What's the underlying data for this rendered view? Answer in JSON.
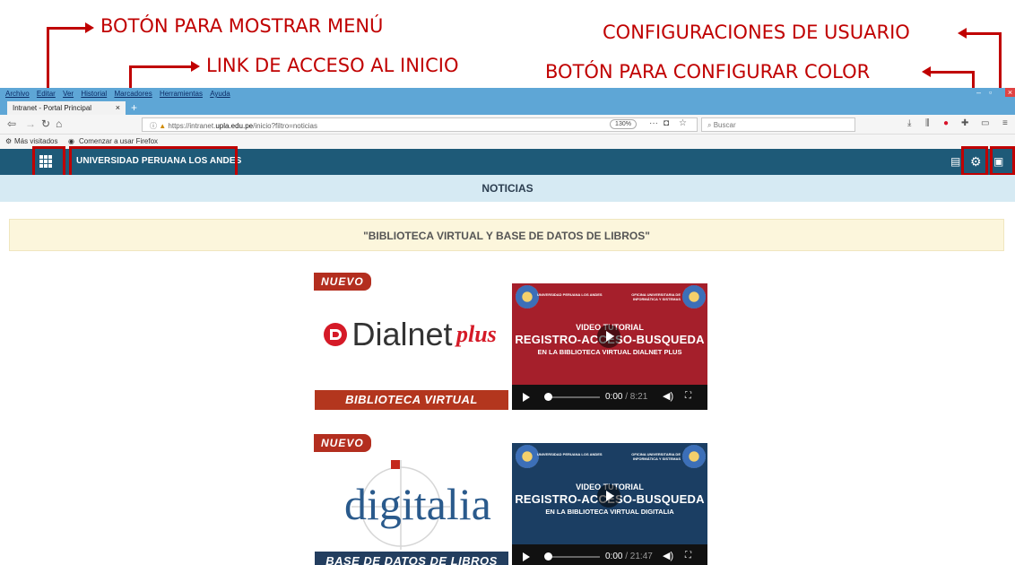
{
  "annotations": {
    "menu_button": "BOTÓN PARA MOSTRAR MENÚ",
    "home_link": "LINK DE ACCESO AL INICIO",
    "user_settings": "CONFIGURACIONES DE USUARIO",
    "color_button": "BOTÓN PARA CONFIGURAR COLOR"
  },
  "browser": {
    "menu": [
      "Archivo",
      "Editar",
      "Ver",
      "Historial",
      "Marcadores",
      "Herramientas",
      "Ayuda"
    ],
    "tab_title": "Intranet - Portal Principal",
    "tab_close": "×",
    "new_tab": "+",
    "url_prefix": "https://intranet.",
    "url_domain": "upla.edu.pe",
    "url_path": "/inicio?filtro=noticias",
    "zoom": "130%",
    "search_placeholder": "Buscar",
    "bookmark_1": "Más visitados",
    "bookmark_2": "Comenzar a usar Firefox"
  },
  "header": {
    "title": "UNIVERSIDAD PERUANA LOS ANDES"
  },
  "section_title": "NOTICIAS",
  "banner_text": "\"BIBLIOTECA VIRTUAL Y BASE DE DATOS DE LIBROS\"",
  "cards": [
    {
      "badge": "NUEVO",
      "logo_main": "Dialnet",
      "logo_suffix": "plus",
      "footer": "BIBLIOTECA VIRTUAL",
      "video": {
        "org_left": "UNIVERSIDAD PERUANA LOS ANDES",
        "org_right": "OFICINA UNIVERSITARIA DE INFORMÁTICA Y SISTEMAS",
        "line1": "VIDEO TUTORIAL",
        "line2": "REGISTRO-ACCESO-BUSQUEDA",
        "line3": "EN LA BIBLIOTECA VIRTUAL DIALNET PLUS",
        "time_current": "0:00",
        "time_total": " / 8:21",
        "bg": "#a51f2b"
      }
    },
    {
      "badge": "NUEVO",
      "logo_main": "digitalia",
      "footer": "BASE DE DATOS DE LIBROS",
      "video": {
        "org_left": "UNIVERSIDAD PERUANA LOS ANDES",
        "org_right": "OFICINA UNIVERSITARIA DE INFORMÁTICA Y SISTEMAS",
        "line1": "VIDEO TUTORIAL",
        "line2": "REGISTRO-ACCESO-BUSQUEDA",
        "line3": "EN LA BIBLIOTECA VIRTUAL DIGITALIA",
        "time_current": "0:00",
        "time_total": " / 21:47",
        "bg": "#1b3e63"
      }
    }
  ],
  "colors": {
    "accent": "#c00000",
    "header": "#1e5a78",
    "badge": "#b32e1f",
    "noticias_bg": "#d6eaf3",
    "banner_bg": "#fcf6dc"
  }
}
